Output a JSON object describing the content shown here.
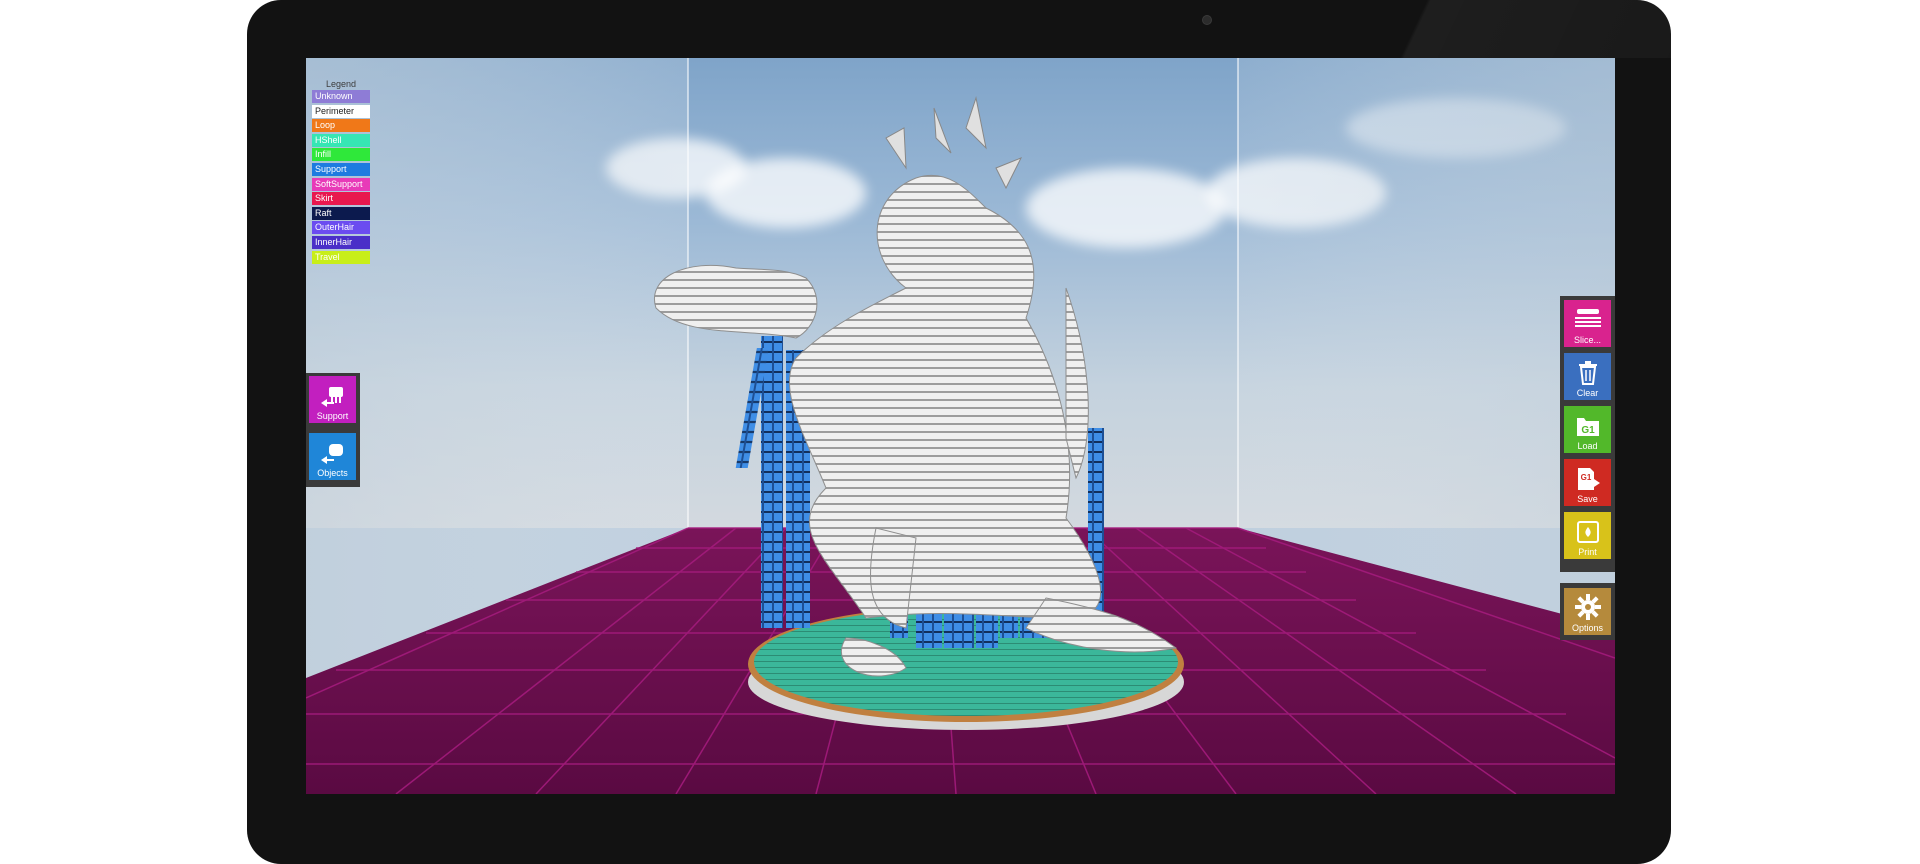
{
  "legend": {
    "title": "Legend",
    "items": [
      {
        "label": "Unknown",
        "color": "#8e7cd6",
        "text_color": "#ffffff"
      },
      {
        "label": "Perimeter",
        "color": "#ffffff",
        "text_color": "#222222"
      },
      {
        "label": "Loop",
        "color": "#f07818",
        "text_color": "#ffffff"
      },
      {
        "label": "HShell",
        "color": "#36e6b4",
        "text_color": "#ffffff"
      },
      {
        "label": "Infill",
        "color": "#2fe83a",
        "text_color": "#ffffff"
      },
      {
        "label": "Support",
        "color": "#1e7be0",
        "text_color": "#ffffff"
      },
      {
        "label": "SoftSupport",
        "color": "#e83ab8",
        "text_color": "#ffffff"
      },
      {
        "label": "Skirt",
        "color": "#e8184e",
        "text_color": "#ffffff"
      },
      {
        "label": "Raft",
        "color": "#0c1a4e",
        "text_color": "#ffffff"
      },
      {
        "label": "OuterHair",
        "color": "#6b4cf0",
        "text_color": "#ffffff"
      },
      {
        "label": "InnerHair",
        "color": "#4a2fc8",
        "text_color": "#ffffff"
      },
      {
        "label": "Travel",
        "color": "#c8ee1a",
        "text_color": "#ffffff"
      }
    ]
  },
  "left_tools": [
    {
      "label": "Support",
      "icon": "support-icon",
      "color": "#c21fbf"
    },
    {
      "label": "Objects",
      "icon": "objects-icon",
      "color": "#1f86d8"
    }
  ],
  "right_tools": [
    {
      "label": "Slice...",
      "icon": "slice-icon",
      "color": "#d9238e"
    },
    {
      "label": "Clear",
      "icon": "trash-icon",
      "color": "#3a6fbf"
    },
    {
      "label": "Load",
      "icon": "load-gcode-icon",
      "icon_text": "G1",
      "color": "#52b82a"
    },
    {
      "label": "Save",
      "icon": "save-gcode-icon",
      "icon_text": "G1",
      "color": "#cf2a22"
    },
    {
      "label": "Print",
      "icon": "print-icon",
      "color": "#d8c21a"
    }
  ],
  "options_tool": {
    "label": "Options",
    "icon": "gear-icon",
    "color": "#b58a3c"
  },
  "viewport": {
    "floor_color": "#6a0e4e",
    "grid_color": "#a01a78",
    "support_color": "#3f8ee6",
    "model_color": "#e9e9e9",
    "raft_top_color": "#3bb79a"
  }
}
